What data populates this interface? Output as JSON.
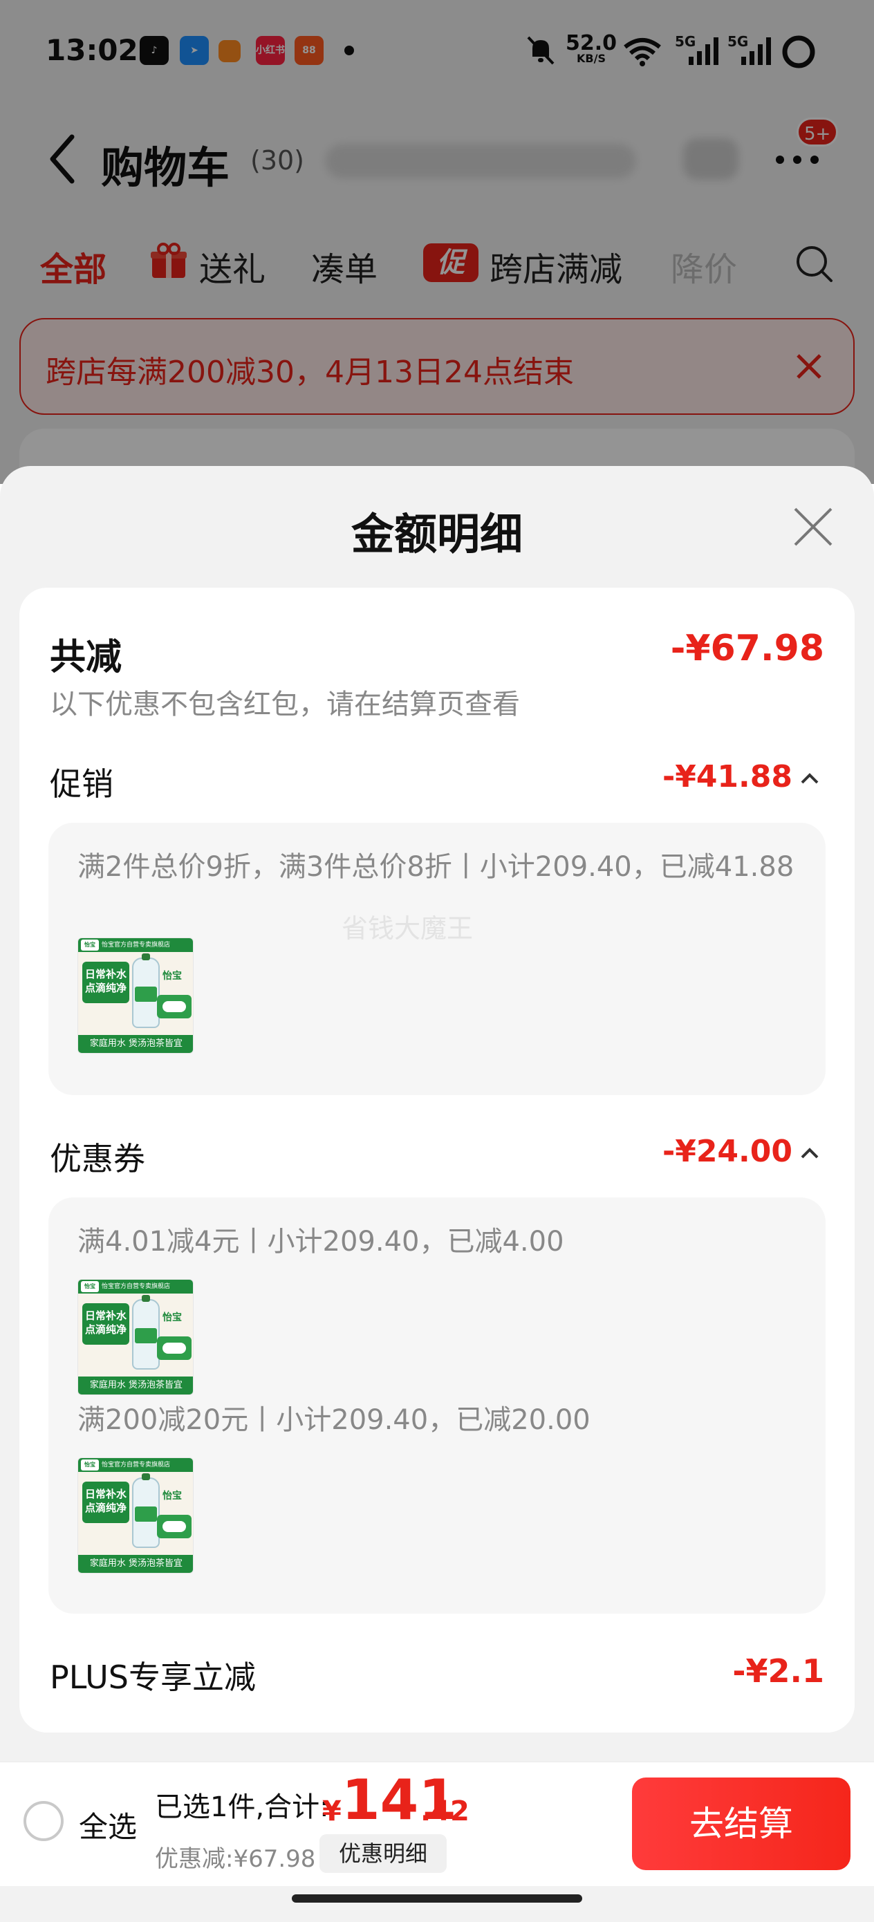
{
  "status_bar": {
    "time": "13:02",
    "speed_value": "52.0",
    "speed_unit": "KB/S",
    "network_1": "5G",
    "network_2": "5G"
  },
  "nav": {
    "title": "购物车",
    "count": "(30)",
    "badge": "5+"
  },
  "tabs": [
    {
      "label": "全部",
      "active": true
    },
    {
      "label": "送礼",
      "icon": "gift-icon"
    },
    {
      "label": "凑单"
    },
    {
      "label": "跨店满减",
      "tag": "促"
    },
    {
      "label": "降价"
    }
  ],
  "promo_banner": {
    "text": "跨店每满200减30，4月13日24点结束"
  },
  "sheet": {
    "title": "金额明细"
  },
  "summary": {
    "total_label": "共减",
    "total_value": "-¥67.98",
    "note": "以下优惠不包含红包，请在结算页查看"
  },
  "promotion": {
    "label": "促销",
    "value": "-¥41.88",
    "detail": "满2件总价9折，满3件总价8折丨小计209.40，已减41.88"
  },
  "watermark": "省钱大魔王",
  "coupon": {
    "label": "优惠券",
    "value": "-¥24.00",
    "items": [
      {
        "detail": "满4.01减4元丨小计209.40，已减4.00"
      },
      {
        "detail": "满200减20元丨小计209.40，已减20.00"
      }
    ]
  },
  "plus": {
    "label": "PLUS专享立减",
    "value": "-¥2.1"
  },
  "product_thumb": {
    "top_band": "怡宝官方自营专卖旗舰店",
    "logo": "怡宝",
    "slogan_line1": "日常补水",
    "slogan_line2": "点滴纯净",
    "brand": "怡宝",
    "bottom_band": "家庭用水 煲汤泡茶皆宜"
  },
  "bottom_bar": {
    "select_all": "全选",
    "selected_text": "已选1件,合计:",
    "currency": "¥",
    "price_int": "141",
    "price_dec": ".42",
    "discount_text": "优惠减:¥67.98",
    "detail_button": "优惠明细",
    "checkout_button": "去结算"
  },
  "colors": {
    "accent": "#e8231a",
    "product_green": "#1f8a3c"
  }
}
